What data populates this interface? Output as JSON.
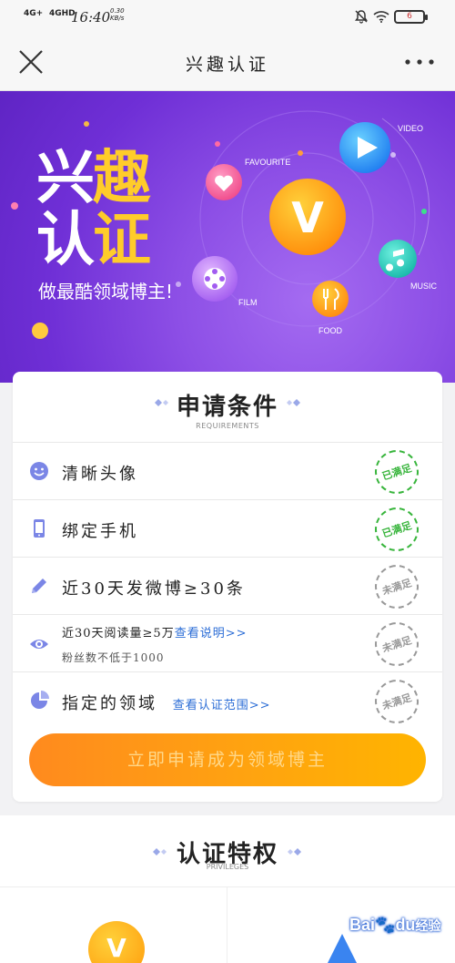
{
  "status_bar": {
    "network1": "4G+",
    "network2": "4GHD",
    "time": "16:40",
    "speed": "0.30\nKB/s",
    "battery": "6"
  },
  "nav": {
    "title": "兴趣认证",
    "close_icon": "close-icon",
    "more_icon": "more-icon"
  },
  "banner": {
    "title_line1": "兴趣",
    "title_line2": "认证",
    "slogan": "做最酷领域博主!",
    "labels": {
      "favourite": "FAVOURITE",
      "video": "VIDEO",
      "film": "FILM",
      "food": "FOOD",
      "music": "MUSIC"
    },
    "center_letter": "V",
    "colors": {
      "bg": "#6f2fd6",
      "accent": "#ffcc2a"
    }
  },
  "requirements": {
    "title": "申请条件",
    "subtitle": "REQUIREMENTS",
    "items": [
      {
        "icon": "smiley-icon",
        "text": "清晰头像",
        "status": "已满足",
        "met": true
      },
      {
        "icon": "phone-icon",
        "text": "绑定手机",
        "status": "已满足",
        "met": true
      },
      {
        "icon": "pencil-icon",
        "text": "近30天发微博≥30条",
        "status": "未满足",
        "met": false
      },
      {
        "icon": "eye-icon",
        "text": "近30天阅读量≥5万",
        "link": "查看说明>>",
        "line2": "粉丝数不低于1000",
        "status": "未满足",
        "met": false
      },
      {
        "icon": "pie-icon",
        "text": "指定的领域",
        "link": "查看认证范围>>",
        "status": "未满足",
        "met": false
      }
    ],
    "apply_button": "立即申请成为领域博主"
  },
  "privileges": {
    "title": "认证特权",
    "subtitle": "PRIVILEGES",
    "icon1_letter": "V"
  },
  "watermark": {
    "brand": "Bai",
    "brand2": "du",
    "cn": "经验"
  }
}
